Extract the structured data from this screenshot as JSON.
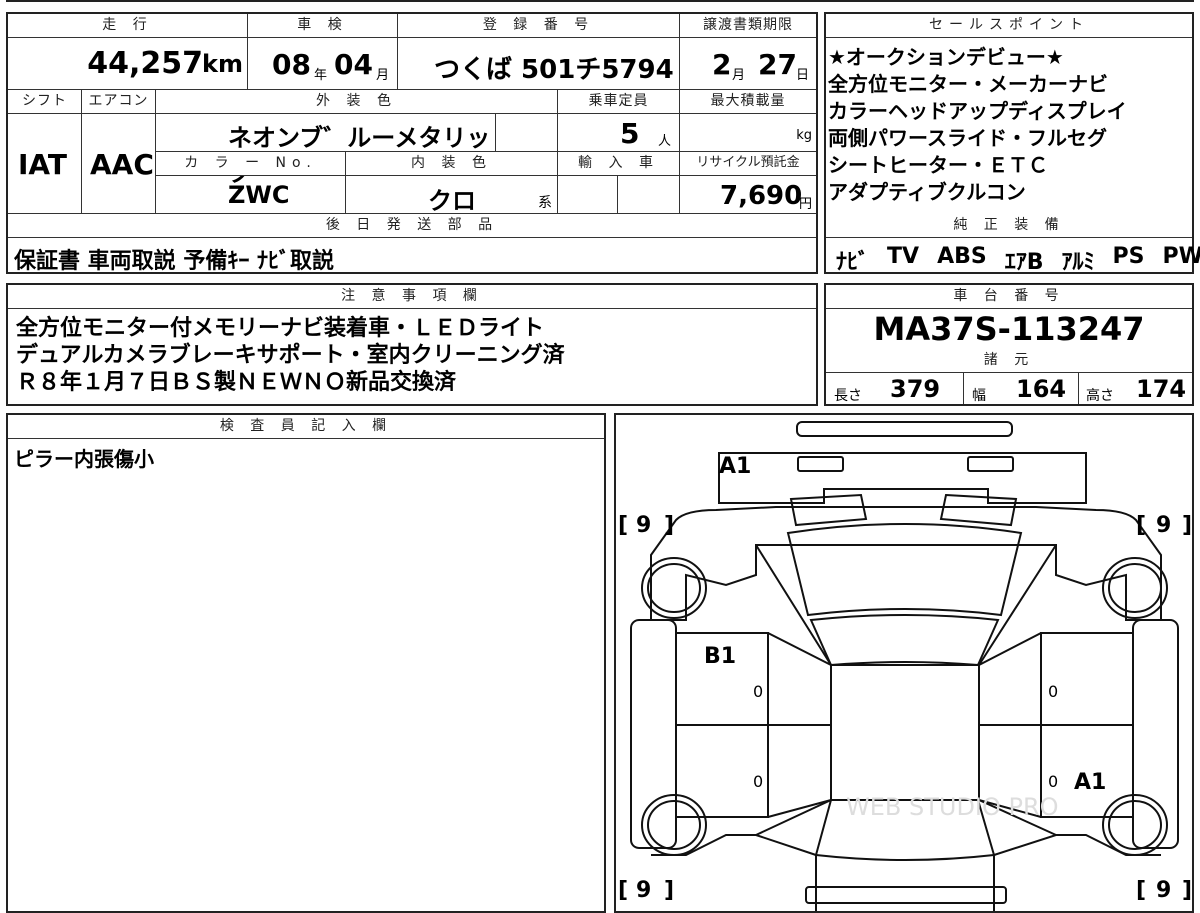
{
  "header_row": {
    "mileage_label": "走 行",
    "mileage_value": "44,257",
    "mileage_unit": "km",
    "inspection_label": "車 検",
    "inspection_year": "08",
    "inspection_year_unit": "年",
    "inspection_month": "04",
    "inspection_month_unit": "月",
    "registration_label": "登 録 番 号",
    "registration_value": "つくば 501チ5794",
    "transfer_deadline_label": "譲渡書類期限",
    "transfer_month": "2",
    "transfer_month_unit": "月",
    "transfer_day": "27",
    "transfer_day_unit": "日"
  },
  "spec_row": {
    "shift_label": "シフト",
    "shift_value": "IAT",
    "aircon_label": "エアコン",
    "aircon_value": "AAC",
    "exterior_color_label": "外 装 色",
    "exterior_color_value": "ネオンブ゛ルーメタリック",
    "capacity_label": "乗車定員",
    "capacity_value": "5",
    "capacity_unit": "人",
    "max_load_label": "最大積載量",
    "max_load_unit": "kg",
    "color_no_label": "カ ラ ー No.",
    "color_no_value": "ZWC",
    "interior_color_label": "内 装 色",
    "interior_color_value": "クロ",
    "interior_color_suffix": "系",
    "import_label": "輸 入 車",
    "recycle_label": "リサイクル預託金",
    "recycle_value": "7,690",
    "recycle_unit": "円"
  },
  "later_parts": {
    "label": "後 日 発 送 部 品",
    "value": "保証書 車両取説 予備ｷｰ ﾅﾋﾞ取説"
  },
  "sales_points": {
    "label": "セールスポイント",
    "lines": [
      "★オークションデビュー★",
      "全方位モニター・メーカーナビ",
      "カラーヘッドアップディスプレイ",
      "両側パワースライド・フルセグ",
      "シートヒーター・ＥＴＣ",
      "アダプティブクルコン"
    ]
  },
  "standard_equipment": {
    "label": "純 正 装 備",
    "items": [
      "ﾅﾋﾞ",
      "TV",
      "ABS",
      "ｴｱB",
      "ｱﾙﾐ",
      "PS",
      "PW"
    ]
  },
  "notes": {
    "label": "注 意 事 項 欄",
    "lines": [
      "全方位モニター付メモリーナビ装着車・ＬＥＤライト",
      "デュアルカメラブレーキサポート・室内クリーニング済",
      "Ｒ８年１月７日ＢＳ製ＮＥＷＮＯ新品交換済"
    ]
  },
  "chassis": {
    "label": "車 台 番 号",
    "value": "MA37S-113247"
  },
  "dimensions": {
    "label": "諸 元",
    "length_label": "長さ",
    "length_value": "379",
    "width_label": "幅",
    "width_value": "164",
    "height_label": "高さ",
    "height_value": "174"
  },
  "inspector": {
    "label": "検 査 員 記 入 欄",
    "comment": "ピラー内張傷小"
  },
  "diagram": {
    "marks": {
      "front_bumper": "A1",
      "left_front_door": "B1",
      "right_rear_door": "A1",
      "zero": "0"
    },
    "tire_tread": "9",
    "bracket_open": "[",
    "bracket_close": "]",
    "watermark": "WEB STUDIO PRO"
  }
}
